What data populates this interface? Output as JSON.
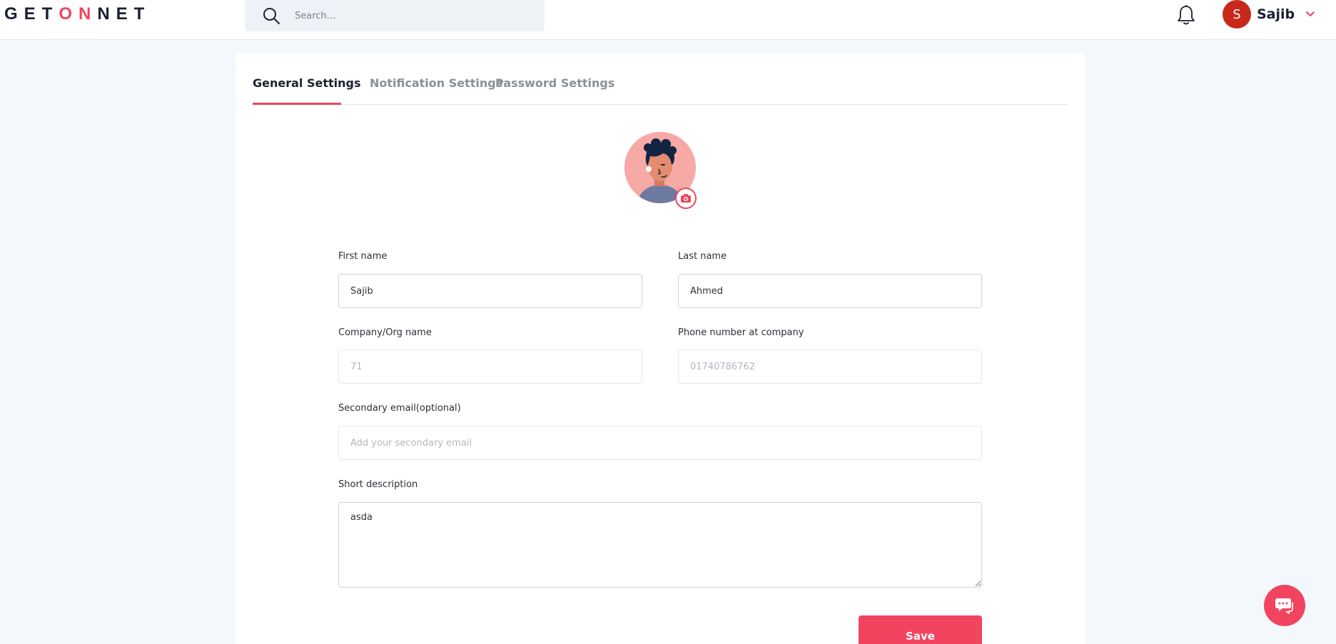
{
  "header": {
    "logo": {
      "part1": "GET",
      "part2": "ON",
      "part3": "NET"
    },
    "search": {
      "placeholder": "Search...",
      "icon": "search-icon"
    },
    "notification_icon": "bell-icon",
    "user": {
      "initial": "S",
      "name": "Sajib",
      "avatar_color": "#c8281a"
    }
  },
  "tabs": [
    {
      "label": "General Settings",
      "active": true
    },
    {
      "label": "Notification Settings",
      "active": false
    },
    {
      "label": "Password Settings",
      "active": false
    }
  ],
  "profile": {
    "camera_icon": "camera-icon"
  },
  "form": {
    "first_name": {
      "label": "First name",
      "value": "Sajib"
    },
    "last_name": {
      "label": "Last name",
      "value": "Ahmed"
    },
    "company": {
      "label": "Company/Org name",
      "placeholder": "71"
    },
    "phone": {
      "label": "Phone number at company",
      "placeholder": "01740786762"
    },
    "secondary_email": {
      "label": "Secondary email(optional)",
      "placeholder": "Add your secondary email"
    },
    "description": {
      "label": "Short description",
      "value": "asda"
    },
    "save_label": "Save"
  },
  "chat_icon": "chat-icon",
  "colors": {
    "accent": "#f2445f",
    "background": "#f2f8fb",
    "text": "#1b2030"
  }
}
